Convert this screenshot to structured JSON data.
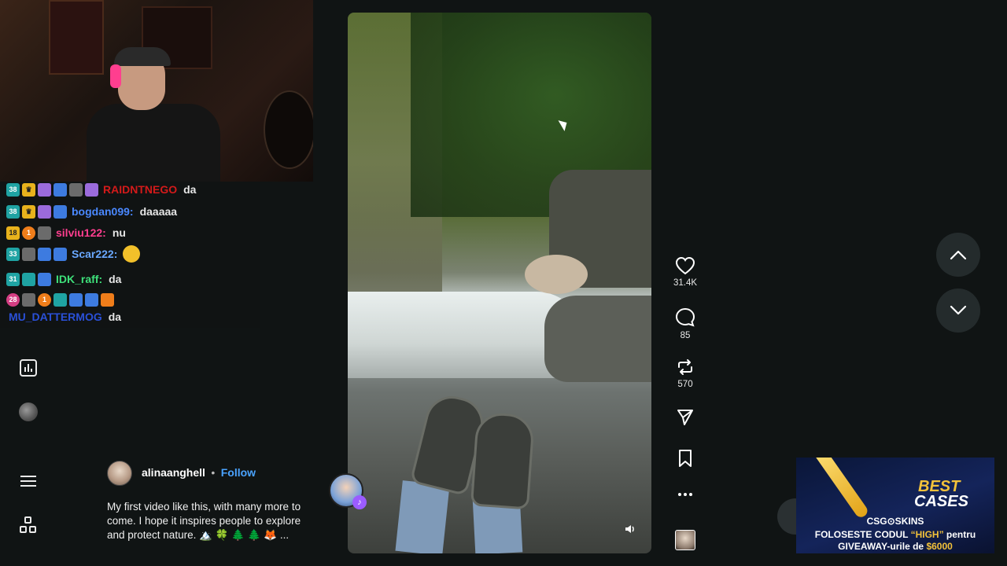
{
  "chat": {
    "lines": [
      {
        "badge": "38",
        "user": "RAIDNTNEGO",
        "msg": "da",
        "color": "#d31a1a"
      },
      {
        "badge": "38",
        "user": "bogdan099:",
        "msg": "daaaaa",
        "color": "#4a88ff"
      },
      {
        "badge": "18",
        "user": "silviu122:",
        "msg": "nu",
        "color": "#ff3e8f"
      },
      {
        "badge": "33",
        "user": "Scar222:",
        "msg": "",
        "color": "#6aa8ff"
      },
      {
        "badge": "31",
        "user": "IDK_raff:",
        "msg": "da",
        "color": "#3ee07a"
      },
      {
        "badge": "28",
        "user": "MU_DATTERMOG",
        "msg": "da",
        "color": "#2a50d8"
      }
    ]
  },
  "author": {
    "name": "alinaanghell",
    "separator": "•",
    "follow": "Follow",
    "caption": "My first video like this, with many more to come. I hope it inspires people to explore and protect nature. 🏔️ 🍀 🌲 🌲 🦊 ..."
  },
  "actions": {
    "likes": "31.4K",
    "comments": "85",
    "reposts": "570"
  },
  "ad": {
    "best": "BEST",
    "cases": "CASES",
    "brand": "CSG⊙SKINS",
    "line1_pre": "FOLOSESTE CODUL ",
    "line1_code": "“HIGH”",
    "line1_post": " pentru",
    "line2_pre": "GIVEAWAY-urile de ",
    "line2_amount": "$6000"
  },
  "icons": {
    "like": "heart-icon",
    "comment": "comment-icon",
    "repost": "repost-icon",
    "share": "send-icon",
    "save": "bookmark-icon",
    "more": "more-icon",
    "up": "chevron-up-icon",
    "down": "chevron-down-icon"
  }
}
